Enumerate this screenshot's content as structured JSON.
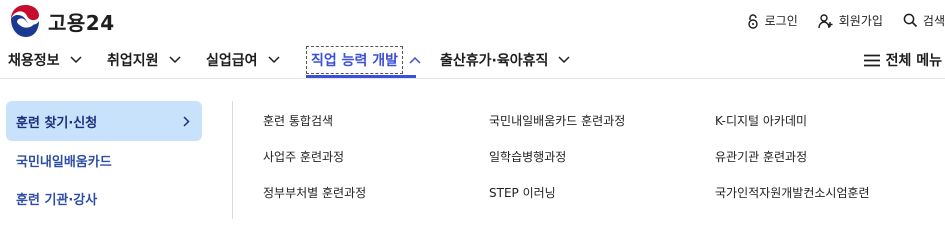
{
  "site": {
    "logo_text": "고용24"
  },
  "util_nav": {
    "login": "로그인",
    "signup": "회원가입",
    "search": "검색"
  },
  "gnb": {
    "items": [
      {
        "label": "채용정보"
      },
      {
        "label": "취업지원"
      },
      {
        "label": "실업급여"
      },
      {
        "label": "직업 능력 개발"
      },
      {
        "label": "출산휴가·육아휴직"
      }
    ],
    "active_index": 3,
    "all_menu": "전체 메뉴"
  },
  "submenu": {
    "side": [
      {
        "label": "훈련 찾기·신청"
      },
      {
        "label": "국민내일배움카드"
      },
      {
        "label": "훈련 기관·강사"
      }
    ],
    "links": [
      [
        "훈련 통합검색",
        "국민내일배움카드 훈련과정",
        "K-디지털 아카데미"
      ],
      [
        "사업주 훈련과정",
        "일학습병행과정",
        "유관기관 훈련과정"
      ],
      [
        "정부부처별 훈련과정",
        "STEP 이러닝",
        "국가인적자원개발컨소시엄훈련"
      ]
    ]
  },
  "colors": {
    "accent": "#3b4fd8",
    "side_active_bg": "#c9e2fb",
    "side_text": "#2f4ea8"
  }
}
